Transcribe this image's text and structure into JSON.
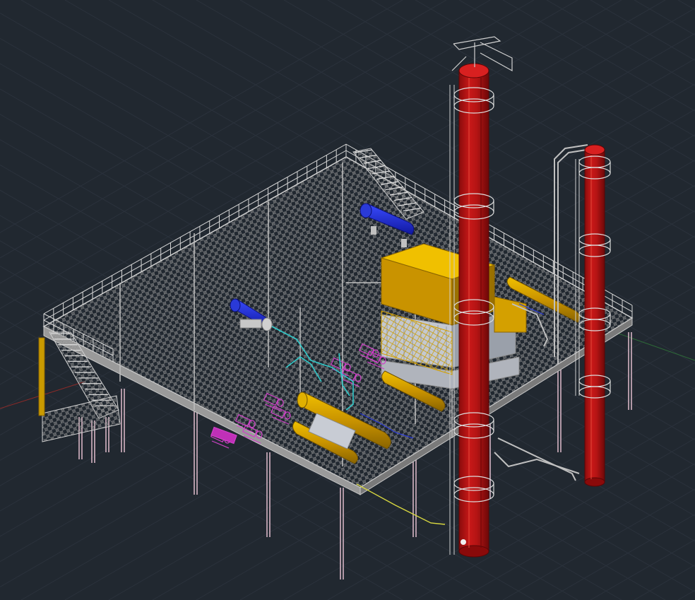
{
  "viewport": {
    "background_color": "#212830",
    "grid_color": "#2b323c",
    "x_axis_color": "#b8362f",
    "y_axis_color": "#2e8a3e"
  },
  "model": {
    "structure_color": "#c8c8c8",
    "deck_mesh_color": "#9a9a9a",
    "column_color": "#d6b4c4",
    "tower_color": "#b01212",
    "tower_highlight_color": "#e23a2a",
    "vessel_yellow_color": "#d4a000",
    "vessel_blue_color": "#1f2fd0",
    "pump_magenta_color": "#d040c8",
    "pipe_cyan_color": "#2fc8c8",
    "pipe_yellow_color": "#d8d840",
    "equipment_gray_color": "#b8bcc4"
  }
}
